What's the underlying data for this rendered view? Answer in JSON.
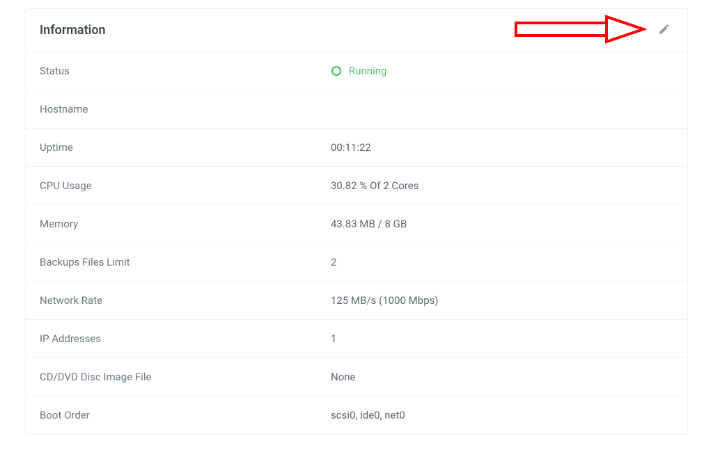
{
  "panel": {
    "title": "Information",
    "edit_label": "Edit"
  },
  "status_row": {
    "label": "Status",
    "value": "Running",
    "color": "#4cc96d"
  },
  "rows": [
    {
      "label": "Hostname",
      "value": ""
    },
    {
      "label": "Uptime",
      "value": "00:11:22"
    },
    {
      "label": "CPU Usage",
      "value": "30.82 % Of 2 Cores"
    },
    {
      "label": "Memory",
      "value": "43.83 MB / 8 GB"
    },
    {
      "label": "Backups Files Limit",
      "value": "2"
    },
    {
      "label": "Network Rate",
      "value": "125 MB/s (1000 Mbps)"
    },
    {
      "label": "IP Addresses",
      "value": "1"
    },
    {
      "label": "CD/DVD Disc Image File",
      "value": "None"
    },
    {
      "label": "Boot Order",
      "value": "scsi0, ide0, net0"
    }
  ]
}
